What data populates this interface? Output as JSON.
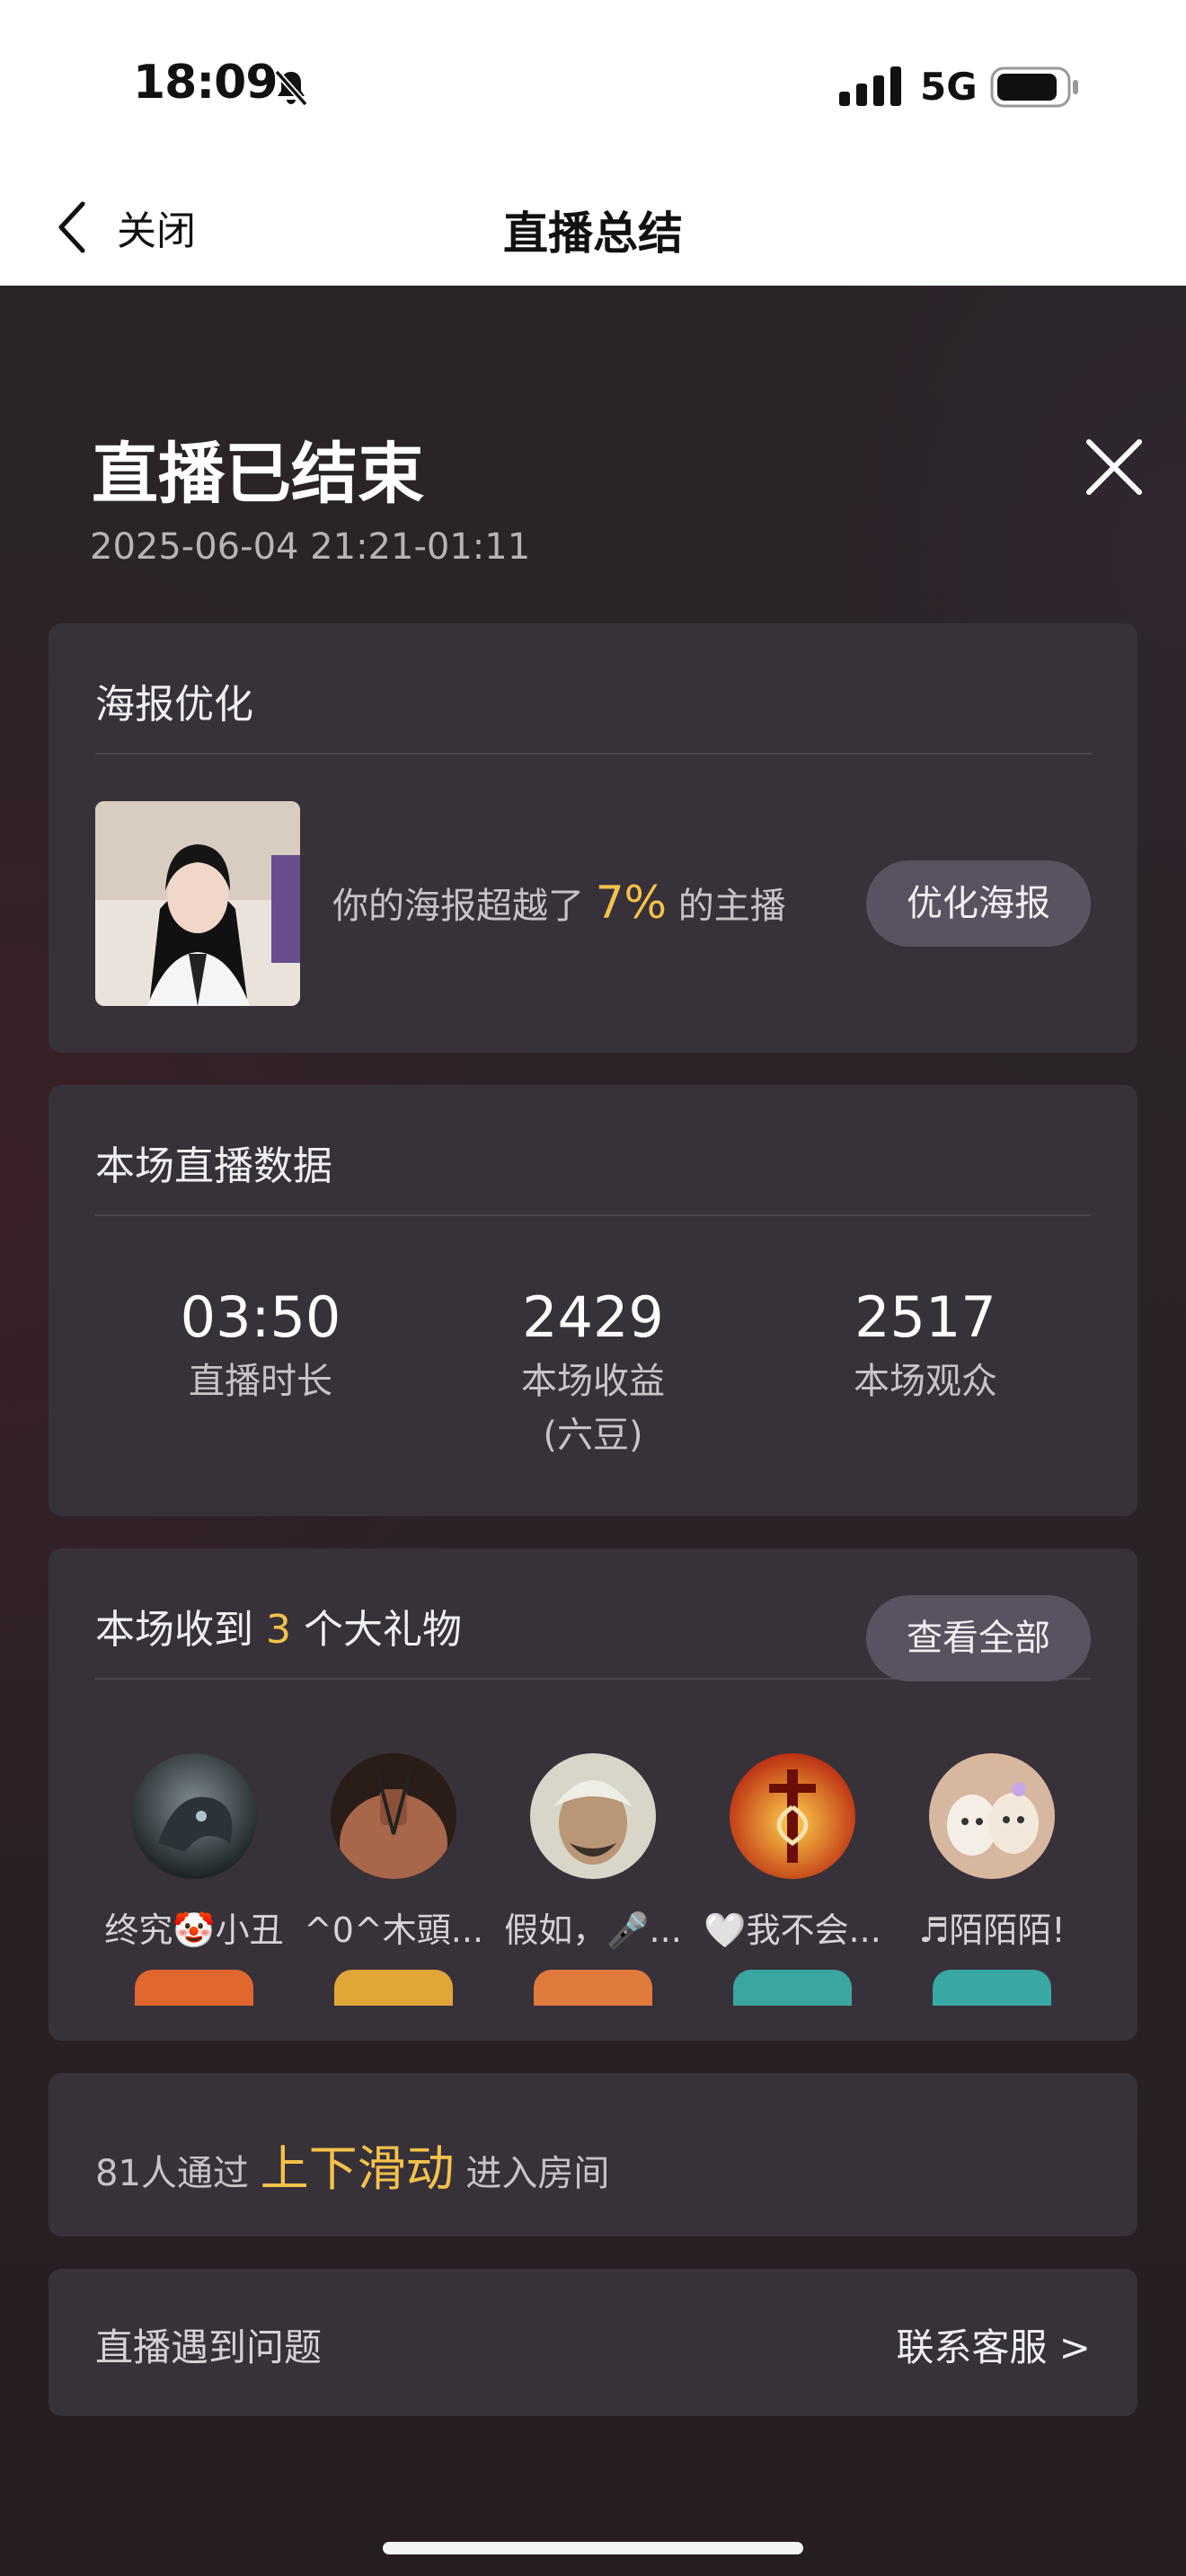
{
  "status_bar": {
    "time": "18:09",
    "network": "5G",
    "icons": [
      "bell-slash-icon",
      "signal-icon",
      "battery-icon"
    ]
  },
  "nav": {
    "back_label": "关闭",
    "title": "直播总结"
  },
  "header": {
    "title": "直播已结束",
    "time_range": "2025-06-04 21:21-01:11"
  },
  "poster": {
    "title": "海报优化",
    "text_prefix": "你的海报超越了",
    "percent": "7%",
    "text_suffix": "的主播",
    "button_label": "优化海报"
  },
  "stats": {
    "title": "本场直播数据",
    "items": [
      {
        "value": "03:50",
        "label": "直播时长",
        "sublabel": ""
      },
      {
        "value": "2429",
        "label": "本场收益",
        "sublabel": "(六豆)"
      },
      {
        "value": "2517",
        "label": "本场观众",
        "sublabel": ""
      }
    ]
  },
  "gifts": {
    "title_prefix": "本场收到",
    "count": "3",
    "title_suffix": "个大礼物",
    "button_label": "查看全部",
    "senders": [
      {
        "name": "终究🤡小丑"
      },
      {
        "name": "^0^木頭..."
      },
      {
        "name": "假如，🎤..."
      },
      {
        "name": "🤍我不会..."
      },
      {
        "name": "♬陌陌陌!"
      }
    ]
  },
  "slide": {
    "prefix": "81人通过",
    "highlight": "上下滑动",
    "suffix": "进入房间"
  },
  "issue": {
    "label": "直播遇到问题",
    "link_label": "联系客服 >"
  },
  "colors": {
    "accent": "#f5c24a",
    "card_bg": "#37313a",
    "button_bg": "#5a5260",
    "page_bg": "#2a2326"
  }
}
